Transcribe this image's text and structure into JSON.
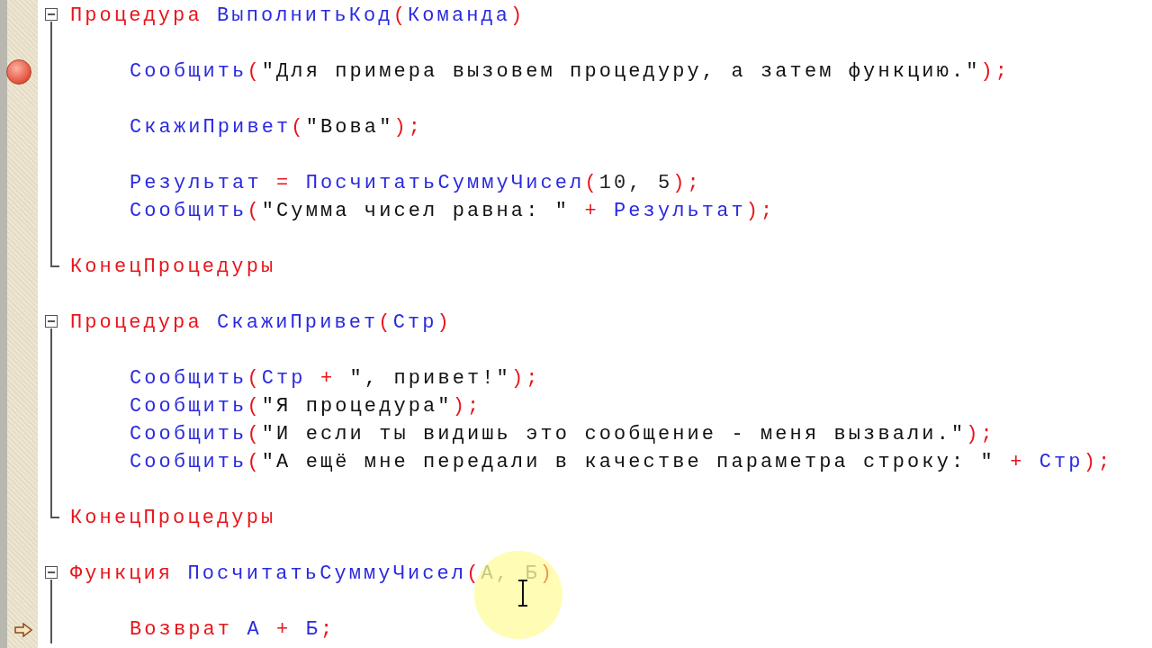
{
  "blocks": [
    {
      "header": [
        {
          "text": "Процедура ",
          "kind": "keyword"
        },
        {
          "text": "ВыполнитьКод",
          "kind": "name"
        },
        {
          "text": "(",
          "kind": "punct"
        },
        {
          "text": "Команда",
          "kind": "name"
        },
        {
          "text": ")",
          "kind": "punct"
        }
      ],
      "lines": [
        {
          "kind": "blank"
        },
        {
          "kind": "code",
          "breakpoint": true,
          "tokens": [
            {
              "text": "Сообщить",
              "kind": "name"
            },
            {
              "text": "(",
              "kind": "punct"
            },
            {
              "text": "\"Для примера вызовем процедуру, а затем функцию.\"",
              "kind": "string"
            },
            {
              "text": ");",
              "kind": "punct"
            }
          ]
        },
        {
          "kind": "blank"
        },
        {
          "kind": "code",
          "tokens": [
            {
              "text": "СкажиПривет",
              "kind": "name"
            },
            {
              "text": "(",
              "kind": "punct"
            },
            {
              "text": "\"Вова\"",
              "kind": "string"
            },
            {
              "text": ");",
              "kind": "punct"
            }
          ]
        },
        {
          "kind": "blank"
        },
        {
          "kind": "code",
          "tokens": [
            {
              "text": "Результат",
              "kind": "name"
            },
            {
              "text": " = ",
              "kind": "punct"
            },
            {
              "text": "ПосчитатьСуммуЧисел",
              "kind": "name"
            },
            {
              "text": "(",
              "kind": "punct"
            },
            {
              "text": "10, 5",
              "kind": "number"
            },
            {
              "text": ");",
              "kind": "punct"
            }
          ]
        },
        {
          "kind": "code",
          "tokens": [
            {
              "text": "Сообщить",
              "kind": "name"
            },
            {
              "text": "(",
              "kind": "punct"
            },
            {
              "text": "\"Сумма чисел равна: \"",
              "kind": "string"
            },
            {
              "text": " + ",
              "kind": "punct"
            },
            {
              "text": "Результат",
              "kind": "name"
            },
            {
              "text": ");",
              "kind": "punct"
            }
          ]
        },
        {
          "kind": "blank"
        }
      ],
      "footer": [
        {
          "text": "КонецПроцедуры",
          "kind": "keyword"
        }
      ]
    },
    {
      "header": [
        {
          "text": "Процедура ",
          "kind": "keyword"
        },
        {
          "text": "СкажиПривет",
          "kind": "name"
        },
        {
          "text": "(",
          "kind": "punct"
        },
        {
          "text": "Стр",
          "kind": "name"
        },
        {
          "text": ")",
          "kind": "punct"
        }
      ],
      "lines": [
        {
          "kind": "blank"
        },
        {
          "kind": "code",
          "tokens": [
            {
              "text": "Сообщить",
              "kind": "name"
            },
            {
              "text": "(",
              "kind": "punct"
            },
            {
              "text": "Стр",
              "kind": "name"
            },
            {
              "text": " + ",
              "kind": "punct"
            },
            {
              "text": "\", привет!\"",
              "kind": "string"
            },
            {
              "text": ");",
              "kind": "punct"
            }
          ]
        },
        {
          "kind": "code",
          "tokens": [
            {
              "text": "Сообщить",
              "kind": "name"
            },
            {
              "text": "(",
              "kind": "punct"
            },
            {
              "text": "\"Я процедура\"",
              "kind": "string"
            },
            {
              "text": ");",
              "kind": "punct"
            }
          ]
        },
        {
          "kind": "code",
          "tokens": [
            {
              "text": "Сообщить",
              "kind": "name"
            },
            {
              "text": "(",
              "kind": "punct"
            },
            {
              "text": "\"И если ты видишь это сообщение - меня вызвали.\"",
              "kind": "string"
            },
            {
              "text": ");",
              "kind": "punct"
            }
          ]
        },
        {
          "kind": "code",
          "tokens": [
            {
              "text": "Сообщить",
              "kind": "name"
            },
            {
              "text": "(",
              "kind": "punct"
            },
            {
              "text": "\"А ещё мне передали в качестве параметра строку: \"",
              "kind": "string"
            },
            {
              "text": " + ",
              "kind": "punct"
            },
            {
              "text": "Стр",
              "kind": "name"
            },
            {
              "text": ");",
              "kind": "punct"
            }
          ]
        },
        {
          "kind": "blank"
        }
      ],
      "footer": [
        {
          "text": "КонецПроцедуры",
          "kind": "keyword"
        }
      ]
    },
    {
      "header": [
        {
          "text": "Функция ",
          "kind": "keyword"
        },
        {
          "text": "ПосчитатьСуммуЧисел",
          "kind": "name"
        },
        {
          "text": "(",
          "kind": "punct"
        },
        {
          "text": "А, Б",
          "kind": "param"
        },
        {
          "text": ")",
          "kind": "punct"
        }
      ],
      "lines": [
        {
          "kind": "blank"
        },
        {
          "kind": "code",
          "marked": true,
          "tokens": [
            {
              "text": "Возврат ",
              "kind": "keyword"
            },
            {
              "text": "А",
              "kind": "name"
            },
            {
              "text": " + ",
              "kind": "punct"
            },
            {
              "text": "Б",
              "kind": "name"
            },
            {
              "text": ";",
              "kind": "punct"
            }
          ]
        }
      ]
    }
  ]
}
